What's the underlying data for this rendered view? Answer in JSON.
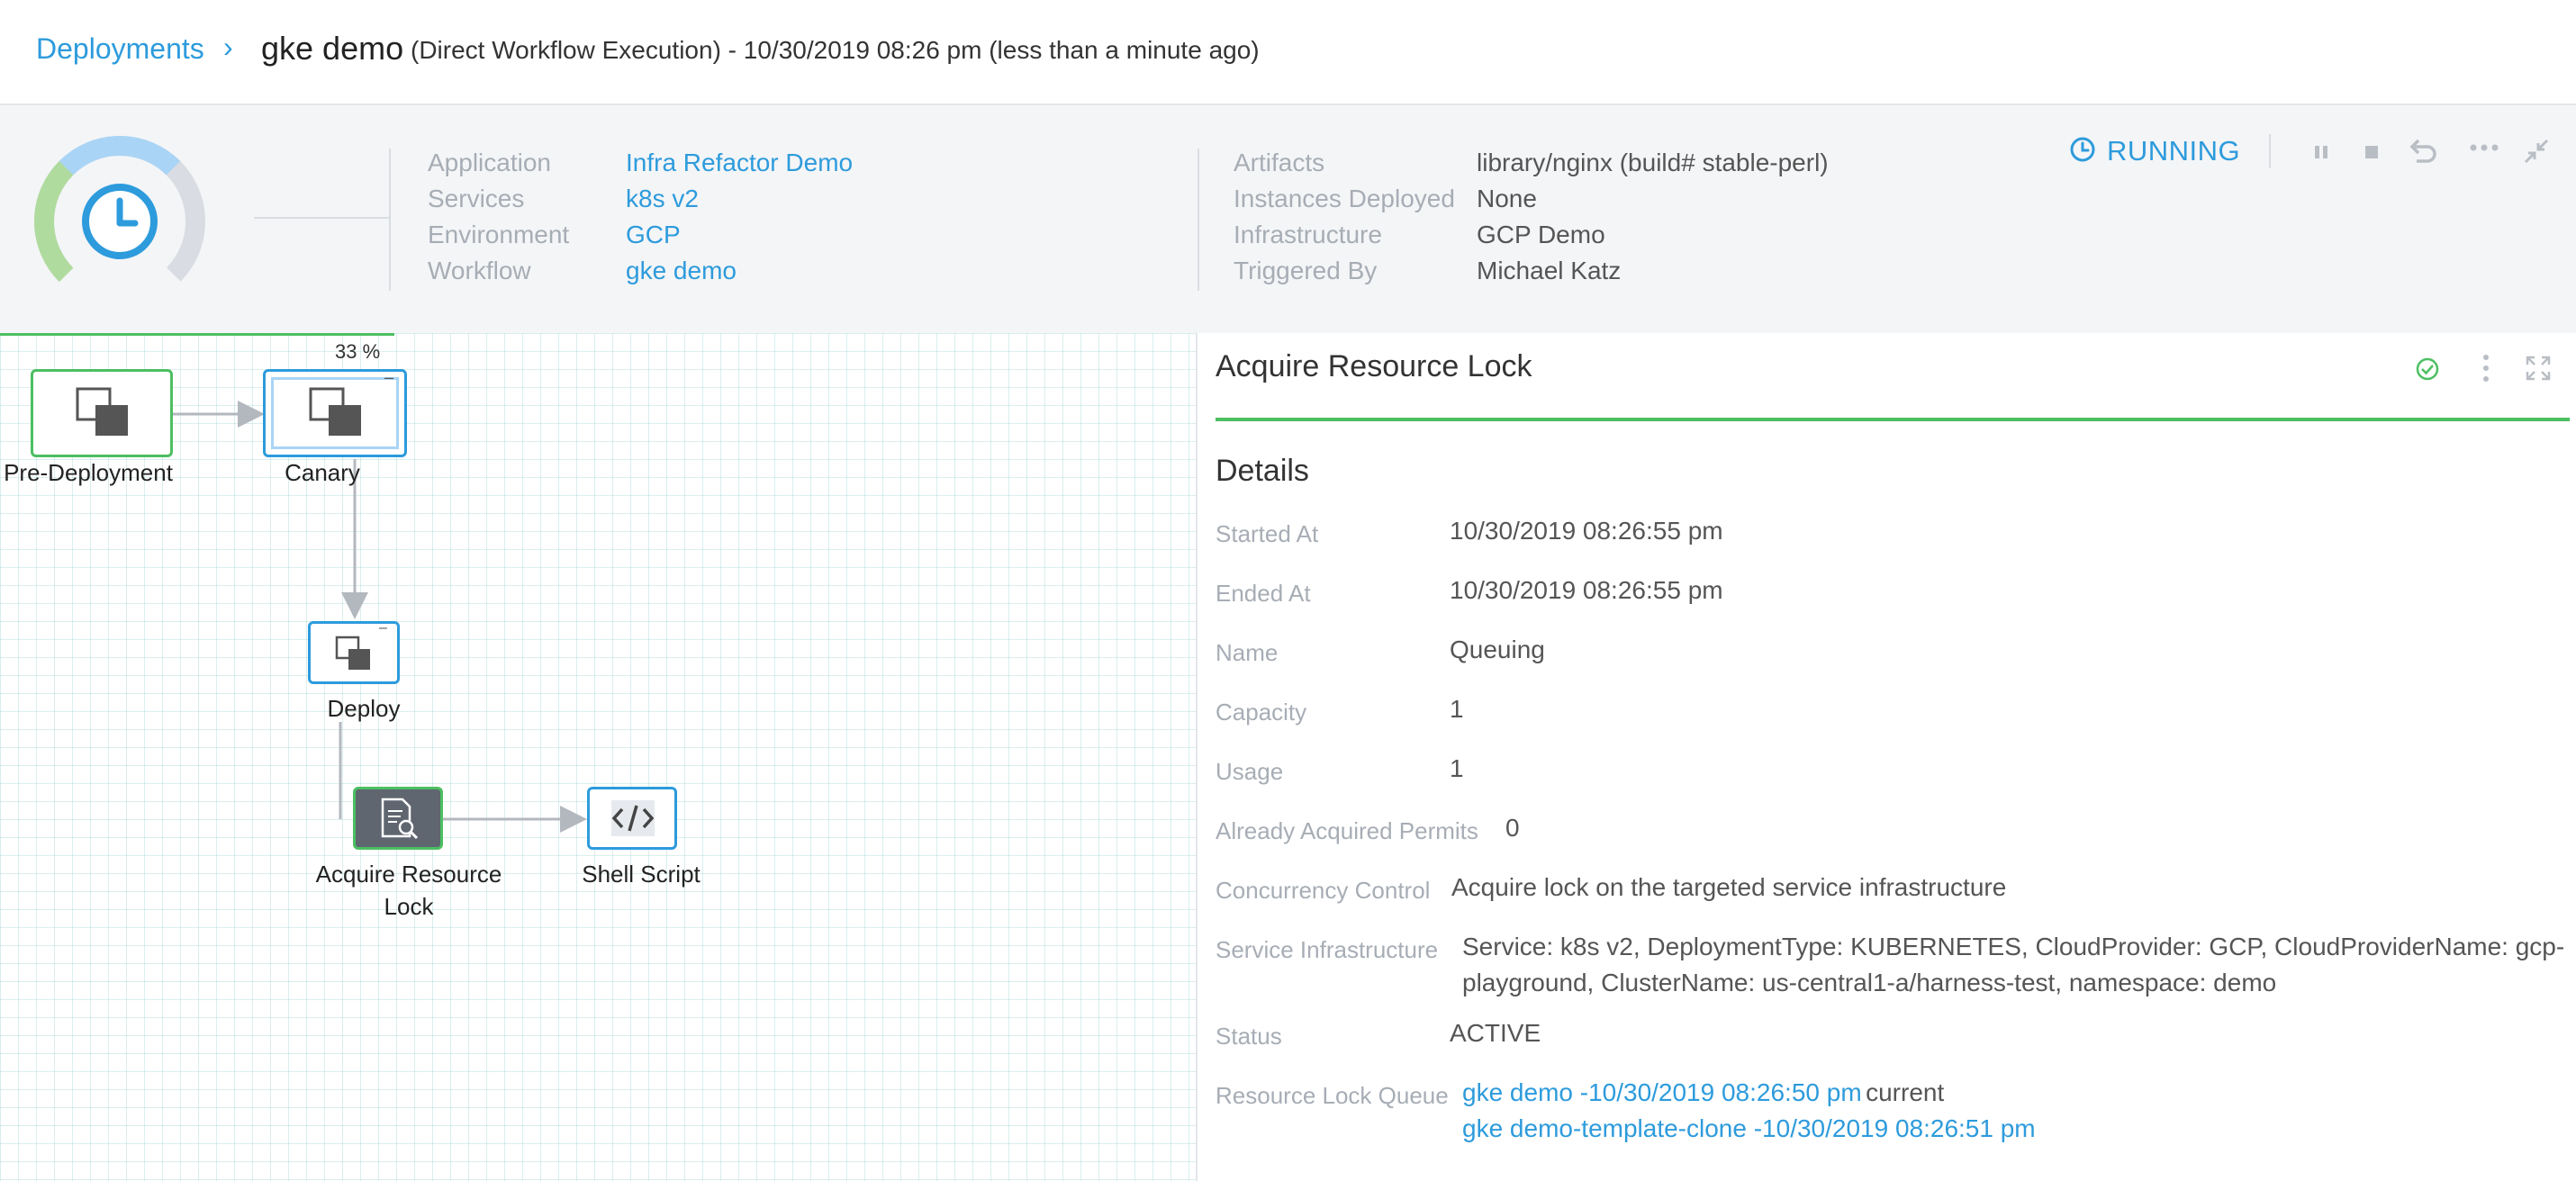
{
  "breadcrumb": {
    "root": "Deployments",
    "separator": "›",
    "title": "gke demo",
    "subtitle": "(Direct Workflow Execution) - 10/30/2019 08:26 pm (less than a minute ago)"
  },
  "summary": {
    "left_fields": [
      {
        "label": "Application",
        "value": "Infra Refactor Demo"
      },
      {
        "label": "Services",
        "value": "k8s v2"
      },
      {
        "label": "Environment",
        "value": "GCP"
      },
      {
        "label": "Workflow",
        "value": "gke demo"
      }
    ],
    "right_fields": [
      {
        "label": "Artifacts",
        "value": "library/nginx (build# stable-perl)"
      },
      {
        "label": "Instances Deployed",
        "value": "None"
      },
      {
        "label": "Infrastructure",
        "value": "GCP Demo"
      },
      {
        "label": "Triggered By",
        "value": "Michael Katz"
      }
    ],
    "status": "RUNNING",
    "icons": [
      "clock-icon",
      "pause-icon",
      "stop-icon",
      "rollback-icon",
      "more-icon",
      "collapse-icon"
    ]
  },
  "workflow": {
    "progress_label": "33 %",
    "progress_fraction": 0.33,
    "nodes": [
      {
        "id": "pre",
        "label": "Pre-Deployment"
      },
      {
        "id": "canary",
        "label": "Canary"
      },
      {
        "id": "deploy",
        "label": "Deploy"
      },
      {
        "id": "lock",
        "label_line1": "Acquire Resource",
        "label_line2": "Lock"
      },
      {
        "id": "shell",
        "label": "Shell Script"
      }
    ]
  },
  "details": {
    "panel_title": "Acquire Resource Lock",
    "section_title": "Details",
    "rows": [
      {
        "label": "Started At",
        "value": "10/30/2019 08:26:55 pm"
      },
      {
        "label": "Ended At",
        "value": "10/30/2019 08:26:55 pm"
      },
      {
        "label": "Name",
        "value": "Queuing"
      },
      {
        "label": "Capacity",
        "value": "1"
      },
      {
        "label": "Usage",
        "value": "1"
      },
      {
        "label": "Already Acquired Permits",
        "value": "0"
      },
      {
        "label": "Concurrency Control",
        "value": "Acquire lock on the targeted service infrastructure"
      },
      {
        "label": "Service Infrastructure",
        "value_line1": "Service: k8s v2, DeploymentType: KUBERNETES, CloudProvider: GCP, CloudProviderName: gcp-",
        "value_line2": "playground, ClusterName: us-central1-a/harness-test, namespace: demo"
      },
      {
        "label": "Status",
        "value": "ACTIVE"
      },
      {
        "label": "Resource Lock Queue",
        "queue": [
          {
            "link": "gke demo -10/30/2019 08:26:50 pm",
            "suffix": "current"
          },
          {
            "link": "gke demo-template-clone -10/30/2019 08:26:51 pm",
            "suffix": ""
          }
        ]
      }
    ]
  },
  "colors": {
    "accent": "#2d9bdc",
    "success": "#4cbf62",
    "dark_node": "#5f6670",
    "label_grey": "#a7adb5"
  }
}
